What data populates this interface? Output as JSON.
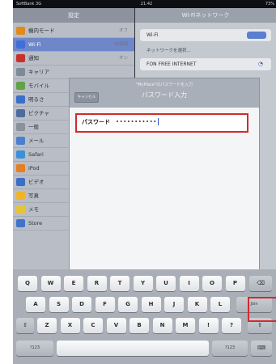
{
  "statusbar": {
    "carrier": "SoftBank 3G",
    "time": "21:42",
    "battery": "73%"
  },
  "settings": {
    "header": "設定",
    "items": [
      {
        "label": "機内モード",
        "icon": "airplane-icon",
        "value": "オフ",
        "color": "#e08a1b"
      },
      {
        "label": "Wi-Fi",
        "icon": "wifi-icon",
        "value": "未接続",
        "color": "#3f6fd8",
        "selected": true
      },
      {
        "label": "通知",
        "icon": "notifications-icon",
        "value": "オン",
        "color": "#c9302c"
      },
      {
        "label": "キャリア",
        "icon": "carrier-icon",
        "value": "",
        "color": "#7f8a97"
      },
      {
        "label": "モバイル",
        "icon": "cellular-icon",
        "value": "",
        "color": "#5fa24a"
      },
      {
        "label": "明るさ",
        "icon": "brightness-icon",
        "value": "",
        "color": "#3a6ec9"
      },
      {
        "label": "ピクチャ",
        "icon": "picture-frame-icon",
        "value": "",
        "color": "#4c6c9f"
      },
      {
        "label": "一般",
        "icon": "gear-icon",
        "value": "",
        "color": "#8b929c"
      },
      {
        "label": "メール",
        "icon": "mail-icon",
        "value": "",
        "color": "#4b7fd0"
      },
      {
        "label": "Safari",
        "icon": "safari-icon",
        "value": "",
        "color": "#3c8fd8"
      },
      {
        "label": "iPod",
        "icon": "ipod-icon",
        "value": "",
        "color": "#e67e22"
      },
      {
        "label": "ビデオ",
        "icon": "video-icon",
        "value": "",
        "color": "#3a6ec9"
      },
      {
        "label": "写真",
        "icon": "photos-icon",
        "value": "",
        "color": "#f0b428"
      },
      {
        "label": "メモ",
        "icon": "notes-icon",
        "value": "",
        "color": "#e6c437"
      },
      {
        "label": "Store",
        "icon": "store-icon",
        "value": "",
        "color": "#3f74c9"
      }
    ]
  },
  "wifi_panel": {
    "header": "Wi-Fiネットワーク",
    "wifi_label": "Wi-Fi",
    "toggle_state": "オン",
    "choose_text": "ネットワークを選択...",
    "networks": [
      {
        "name": "FON FREE INTERNET"
      }
    ]
  },
  "modal": {
    "subtitle": "\"MyPlace\"のパスワードを入力",
    "title": "パスワード入力",
    "cancel_label": "キャンセル",
    "password_label": "パスワード",
    "password_value": "•••••••••••"
  },
  "keyboard": {
    "row1": [
      "Q",
      "W",
      "E",
      "R",
      "T",
      "Y",
      "U",
      "I",
      "O",
      "P"
    ],
    "row2": [
      "A",
      "S",
      "D",
      "F",
      "G",
      "H",
      "J",
      "K",
      "L"
    ],
    "row3": [
      "Z",
      "X",
      "C",
      "V",
      "B",
      "N",
      "M",
      "!",
      "?"
    ],
    "join_label": "Join",
    "mode_left": "?123",
    "mode_right": "?123",
    "backspace": "⌫",
    "shift": "⇧",
    "hide_keyboard": "⌨"
  }
}
